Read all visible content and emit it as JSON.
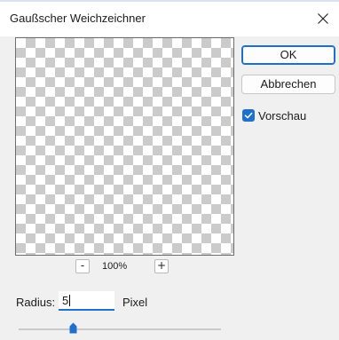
{
  "dialog": {
    "title": "Gaußscher Weichzeichner",
    "close_glyph": "✕"
  },
  "buttons": {
    "ok_label": "OK",
    "cancel_label": "Abbrechen"
  },
  "preview": {
    "checkbox_label": "Vorschau",
    "checked": true,
    "zoom_out_label": "-",
    "zoom_in_label": "+",
    "zoom_value": "100%"
  },
  "radius": {
    "label": "Radius:",
    "value": "5",
    "unit": "Pixel",
    "slider_fraction": 0.27
  },
  "colors": {
    "accent": "#1f6fcf",
    "dialog_bg": "#f0f0f0",
    "checker_dark": "#cbcbcb",
    "checker_light": "#ffffff"
  },
  "icons": {
    "close": "close-icon",
    "check": "checkmark-icon",
    "slider_thumb": "slider-thumb-icon"
  }
}
